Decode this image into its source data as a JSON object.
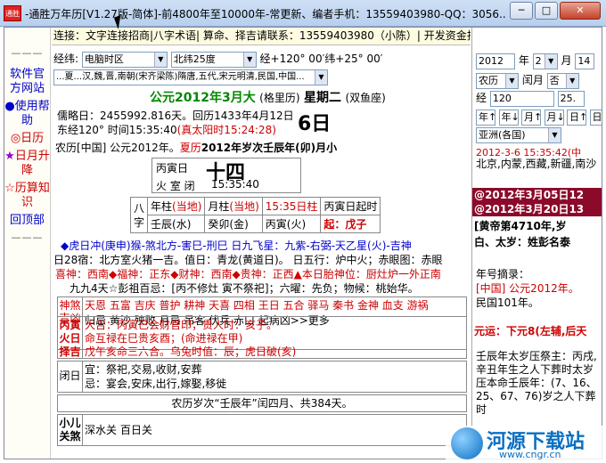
{
  "window": {
    "title": "-通胜万年历[V1.27版-简体]-前4800年至10000年-常更新、编者手机：13559403980-QQ：3056...",
    "icon_text": "通胜",
    "min_label": "─",
    "max_label": "□",
    "close_label": "✕"
  },
  "sidebar": {
    "sep": "———",
    "items": [
      {
        "label": "软件官方网站",
        "bullet": ""
      },
      {
        "label": "使用帮助",
        "bullet": "●"
      },
      {
        "label": "日历",
        "bullet": "◎"
      },
      {
        "label": "日月升降",
        "bullet": "★"
      },
      {
        "label": "历算知识",
        "bullet": "☆"
      },
      {
        "label": "回顶部",
        "bullet": ""
      }
    ]
  },
  "topbar": {
    "text": "连接：文字连接招商|八字术语| 算命、择吉请联系：13559403980（小陈）| 开发资金捐助"
  },
  "location": {
    "label": "经纬:",
    "combo1": "电脑时区",
    "combo2": "北纬25度",
    "coords": "经+120° 00′纬+25° 00′",
    "region": "...夏...汉,魏,晋,南朝(宋齐梁陈)隋唐,五代,宋元明清,民国,中国..."
  },
  "date_header": {
    "gregorian": "公元2012年3月大",
    "calendar_type": "(格里历)",
    "weekday": "星期二",
    "zodiac": "(双鱼座)"
  },
  "info": {
    "julian": "儒略日：2455992.816天。回历1433年4月12日",
    "time": "东经120° 时间15:35:40",
    "solar_time": "(真太阳时15:24:28)",
    "day_big": "6日",
    "lunar_line_prefix": "农历[中国] 公元2012年。",
    "lunar_line_red": "夏历",
    "lunar_line_suffix": "2012年岁次壬辰年(卯)月小"
  },
  "day_box": {
    "stem": "丙寅日",
    "big": "十四",
    "fire": "火 室 闭",
    "time": "15:35:40"
  },
  "pillars": {
    "ba": "八",
    "zi": "字",
    "year_label": "年柱",
    "year_red": "(当地)",
    "month_label": "月柱",
    "month_red": "(当地)",
    "hour_label": "15:35日柱",
    "day_label": "丙寅日起时",
    "year_val": "壬辰(水)",
    "month_val": "癸卯(金)",
    "day_val": "丙寅(火)",
    "hour_val": "起：戊子"
  },
  "lines": {
    "l1": "◆虎日冲(庚申)猴-煞北方-害巳-刑巳 日九飞星：九紫-右弼-天乙星(火)-吉神",
    "l2": "日28宿：北方室火猪一吉。值日：青龙(黄道日)。  日五行：炉中火；赤眼图：赤眼",
    "l3": "喜神：西南◆福神：正东◆财神：西南◆贵神：正西▲本日胎神位：厨灶炉一外正南",
    "l4": "九九4天☆彭祖百忌：[丙不修灶 寅不祭祀]；六曜：先负；物候：桃始华。"
  },
  "gods": {
    "label": "神煞吉凶",
    "row1": "天恩 五富 吉庆 普护 耕神 天喜 四相 王日 五合 驿马 秦书 金神 血支 游祸",
    "row2": "归忌 黄沙 殃败 月忌 吊客 伏兵 赤口 起病凶>>更多"
  },
  "select": {
    "label": "丙寅火日择吉",
    "row1": "大吉：丙寅已会财官印；贵人时：亥子。",
    "row2": "命互禄在巳贵亥酉；(命进禄在甲)",
    "row3": "戊午亥命三六合。乌兔时值：辰；虎日破(亥)"
  },
  "yiji": {
    "label": "闭日",
    "yi": "宜：祭祀,交易,收财,安葬",
    "ji": "忌：宴会,安床,出行,嫁娶,移徙"
  },
  "leap": {
    "text": "农历岁次“壬辰年”闰四月、共384天。"
  },
  "child": {
    "label": "小儿关煞",
    "text": "深水关 百日关"
  },
  "right": {
    "year": "2012",
    "year_unit": "年",
    "month": "2",
    "month_unit": "月",
    "day": "14",
    "cal": "农历",
    "leap_label": "闰月",
    "leap_val": "否",
    "jing": "经",
    "jing_val": "120",
    "wei_val": "25.",
    "nav": [
      "年↑",
      "年↓",
      "月↑",
      "月↓",
      "日↑",
      "日↓"
    ],
    "region": "亚洲(各国)",
    "now": "2012-3-6 15:35:42",
    "now_suffix": "(中",
    "cities": "北京,内蒙,西藏,新疆,南沙",
    "jieqi1": "@2012年3月05日12",
    "jieqi2": "@2012年3月20日13",
    "huangdi": "[黄帝第4710年,岁",
    "taisui": "白、太岁：姓彭名泰",
    "nianhao_label": "年号摘录：",
    "nianhao1": "[中国] 公元2012年。",
    "nianhao2": "民国101年。",
    "yuanyun": "元运：下元8(左辅,后天",
    "ganzhi": "壬辰年太岁压祭主：丙戌,辛丑年生之人下葬时太岁压本命壬辰年：(7、16、25、67、76)岁之人下葬时"
  },
  "watermark": {
    "name": "河源下载站",
    "url": "www.cngr.cn"
  },
  "colors": {
    "red": "#cc0000",
    "blue": "#0000cc",
    "green": "#008800",
    "highlight_bg": "#8b0a2a"
  }
}
